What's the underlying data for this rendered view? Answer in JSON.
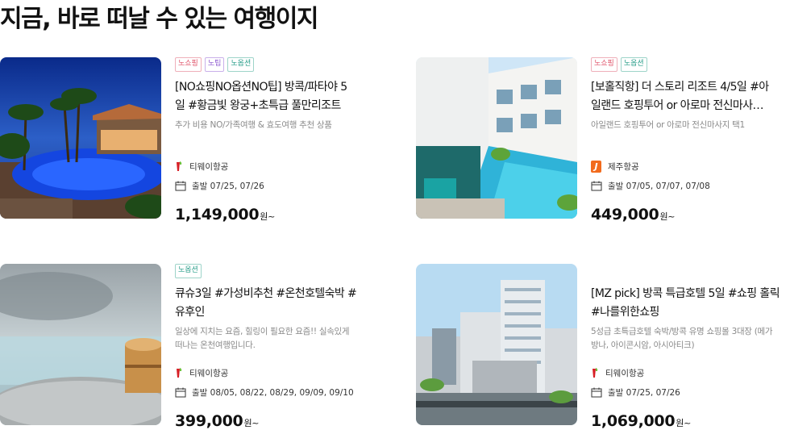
{
  "page_title": "지금, 바로 떠날 수 있는 여행이지",
  "products": [
    {
      "tags": [
        {
          "label": "노쇼핑",
          "color": "red"
        },
        {
          "label": "노팁",
          "color": "purple"
        },
        {
          "label": "노옵션",
          "color": "teal"
        }
      ],
      "title_line1": "[NO쇼핑NO옵션NO팁] 방콕/파타야 5",
      "title_line2": "일 #황금빛 왕궁+초특급 풀만리조트",
      "desc_line1": "추가 비용 NO/가족여행 & 효도여행 추천 상품",
      "desc_line2": "",
      "airline": "티웨이항공",
      "airline_icon": "tway-logo-icon",
      "departure": "출발 07/25, 07/26",
      "price": "1,149,000",
      "price_unit": "원~"
    },
    {
      "tags": [
        {
          "label": "노쇼핑",
          "color": "red"
        },
        {
          "label": "노옵션",
          "color": "teal"
        }
      ],
      "title_line1": "[보홀직항] 더 스토리 리조트 4/5일 #아",
      "title_line2": "일랜드 호핑투어 or 아로마 전신마사…",
      "desc_line1": "아일랜드 호핑투어 or 아로마 전신마사지 택1",
      "desc_line2": "",
      "airline": "제주항공",
      "airline_icon": "jejuair-logo-icon",
      "departure": "출발 07/05, 07/07, 07/08",
      "price": "449,000",
      "price_unit": "원~"
    },
    {
      "tags": [
        {
          "label": "노옵션",
          "color": "teal"
        }
      ],
      "title_line1": "큐슈3일 #가성비추천 #온천호텔숙박 #",
      "title_line2": "유후인",
      "desc_line1": "일상에 지치는 요즘, 힐링이 필요한 요즘!! 실속있게",
      "desc_line2": "떠나는 온천여행입니다.",
      "airline": "티웨이항공",
      "airline_icon": "tway-logo-icon",
      "departure": "출발 08/05, 08/22, 08/29, 09/09, 09/10",
      "price": "399,000",
      "price_unit": "원~"
    },
    {
      "tags": [],
      "title_line1": "[MZ pick] 방콕 특급호텔 5일 #쇼핑 홀릭",
      "title_line2": "#나를위한쇼핑",
      "desc_line1": "5성급 초특급호텔 숙박/방콕 유명 쇼핑몰 3대장 (메가",
      "desc_line2": "방나, 아이콘시암, 아시아티크)",
      "airline": "티웨이항공",
      "airline_icon": "tway-logo-icon",
      "departure": "출발 07/25, 07/26",
      "price": "1,069,000",
      "price_unit": "원~"
    }
  ]
}
